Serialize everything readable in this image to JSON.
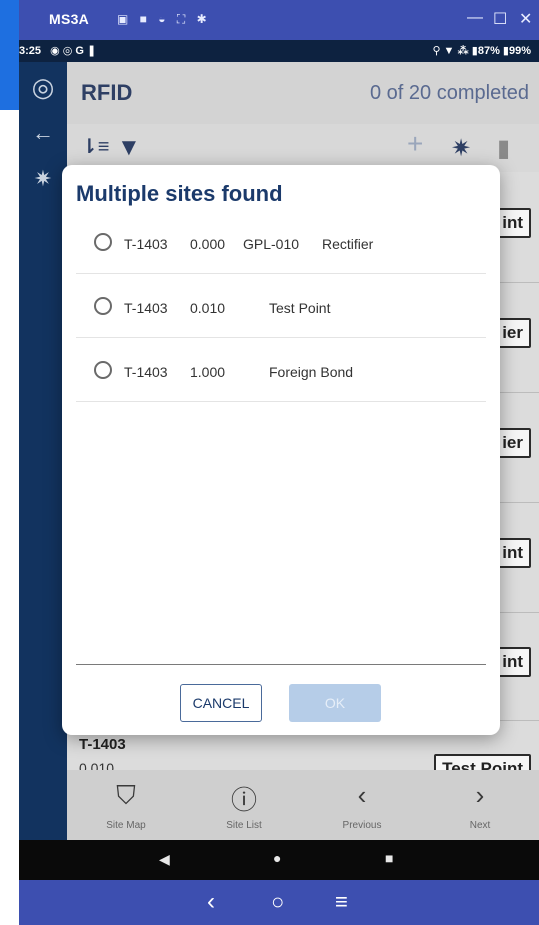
{
  "window": {
    "title": "MS3A",
    "title_icons": "▣ ■ ◒ ⛶ ✱",
    "minimize_glyph": "—",
    "maximize_glyph": "☐",
    "close_glyph": "✕"
  },
  "status_bar": {
    "time": "3:25",
    "left_icons": "◉ ◎ G ❚",
    "right_text": "⚲ ▼ ⁂ ▮87% ▮99%"
  },
  "rail": {
    "icons": [
      "settings-ring-icon",
      "back-arrow-icon",
      "gear-icon"
    ],
    "glyphs": [
      "◎",
      "←",
      "✷"
    ]
  },
  "app_bar": {
    "title": "RFID",
    "progress": "0 of 20 completed"
  },
  "toolbar": {
    "sort_glyph": "⇂≡",
    "filter_glyph": "▼",
    "add_glyph": "+",
    "gear_glyph": "✷",
    "delete_glyph": "▮"
  },
  "background_badges": [
    "int",
    "ier",
    "ier",
    "int",
    "int"
  ],
  "background_last": {
    "id": "T-1403",
    "value": "0.010",
    "badge": "Test Point"
  },
  "bottom_nav": [
    {
      "label": "Site Map",
      "glyph": "⛉",
      "icon": "map-icon"
    },
    {
      "label": "Site List",
      "glyph": "ⓘ",
      "icon": "info-circle-icon"
    },
    {
      "label": "Previous",
      "glyph": "‹",
      "icon": "chevron-left-icon"
    },
    {
      "label": "Next",
      "glyph": "›",
      "icon": "chevron-right-icon"
    }
  ],
  "system_nav": {
    "back": "◀",
    "home": "●",
    "recents": "■"
  },
  "host_nav": {
    "back": "‹",
    "home": "○",
    "menu": "≡"
  },
  "dialog": {
    "title": "Multiple sites found",
    "options": [
      {
        "id": "T-1403",
        "value": "0.000",
        "code": "GPL-010",
        "type": "Rectifier"
      },
      {
        "id": "T-1403",
        "value": "0.010",
        "code": "",
        "type": "Test Point"
      },
      {
        "id": "T-1403",
        "value": "1.000",
        "code": "",
        "type": "Foreign Bond"
      }
    ],
    "cancel_label": "CANCEL",
    "ok_label": "OK"
  }
}
